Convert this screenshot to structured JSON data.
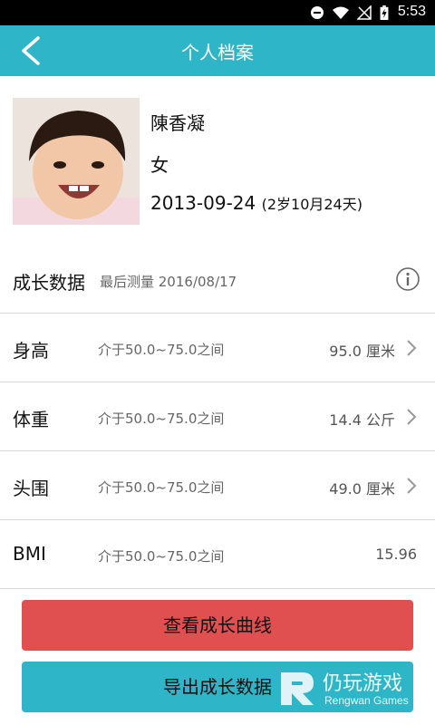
{
  "status_bar": {
    "time": "5:53"
  },
  "app_bar": {
    "title": "个人档案"
  },
  "profile": {
    "name": "陳香凝",
    "gender": "女",
    "birthdate": "2013-09-24",
    "age": "(2岁10月24天)"
  },
  "growth": {
    "title": "成长数据",
    "last_measured": "最后测量 2016/08/17",
    "rows": [
      {
        "label": "身高",
        "range": "介于50.0~75.0之间",
        "value": "95.0 厘米"
      },
      {
        "label": "体重",
        "range": "介于50.0~75.0之间",
        "value": "14.4 公斤"
      },
      {
        "label": "头围",
        "range": "介于50.0~75.0之间",
        "value": "49.0 厘米"
      },
      {
        "label": "BMI",
        "range": "介于50.0~75.0之间",
        "value": "15.96"
      }
    ]
  },
  "buttons": {
    "view_curve": "查看成长曲线",
    "export": "导出成长数据"
  },
  "watermark": {
    "text": "仍玩游戏",
    "sub": "Rengwan Games"
  },
  "colors": {
    "accent": "#2fb5c8",
    "danger": "#e05050"
  }
}
